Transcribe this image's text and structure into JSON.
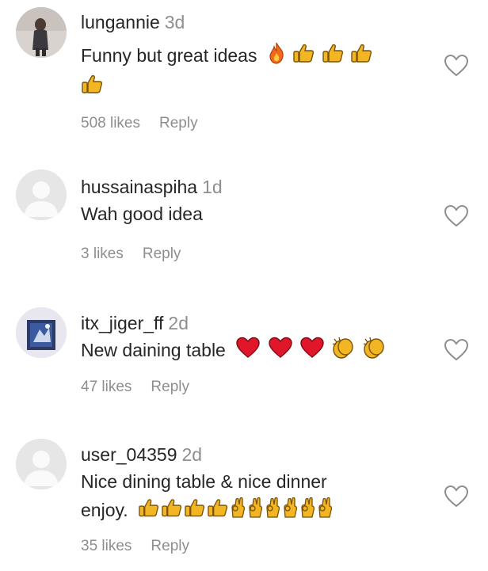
{
  "comments": [
    {
      "username": "lungannie",
      "time": "3d",
      "text": "Funny but great ideas",
      "emojis": [
        "fire",
        "thumbs-up",
        "thumbs-up",
        "thumbs-up"
      ],
      "emojis_line2": [
        "thumbs-up"
      ],
      "likes": "508 likes",
      "reply": "Reply",
      "avatar_icon": "profile-photo-icon"
    },
    {
      "username": "hussainaspiha",
      "time": "1d",
      "text": "Wah good idea",
      "likes": "3 likes",
      "reply": "Reply",
      "avatar_icon": "default-avatar-icon"
    },
    {
      "username": "itx_jiger_ff",
      "time": "2d",
      "text": "New daining table",
      "emojis": [
        "red-heart",
        "red-heart",
        "red-heart",
        "clapping-hands",
        "clapping-hands"
      ],
      "likes": "47 likes",
      "reply": "Reply",
      "avatar_icon": "profile-photo-icon"
    },
    {
      "username": "user_04359",
      "time": "2d",
      "text": "Nice dining table & nice dinner",
      "text_line2": "enjoy.",
      "emojis_line2": [
        "thumbs-up",
        "thumbs-up",
        "thumbs-up",
        "thumbs-up",
        "ok-hand",
        "ok-hand",
        "ok-hand",
        "ok-hand",
        "ok-hand",
        "ok-hand"
      ],
      "likes": "35 likes",
      "reply": "Reply",
      "avatar_icon": "default-avatar-icon"
    }
  ],
  "colors": {
    "text": "#262626",
    "secondary": "#8e8e8e",
    "emoji_yellow": "#f2b524",
    "heart_red": "#e0162b",
    "fire_orange": "#f06a1e"
  },
  "icons": {
    "like_icon": "heart-outline-icon"
  }
}
